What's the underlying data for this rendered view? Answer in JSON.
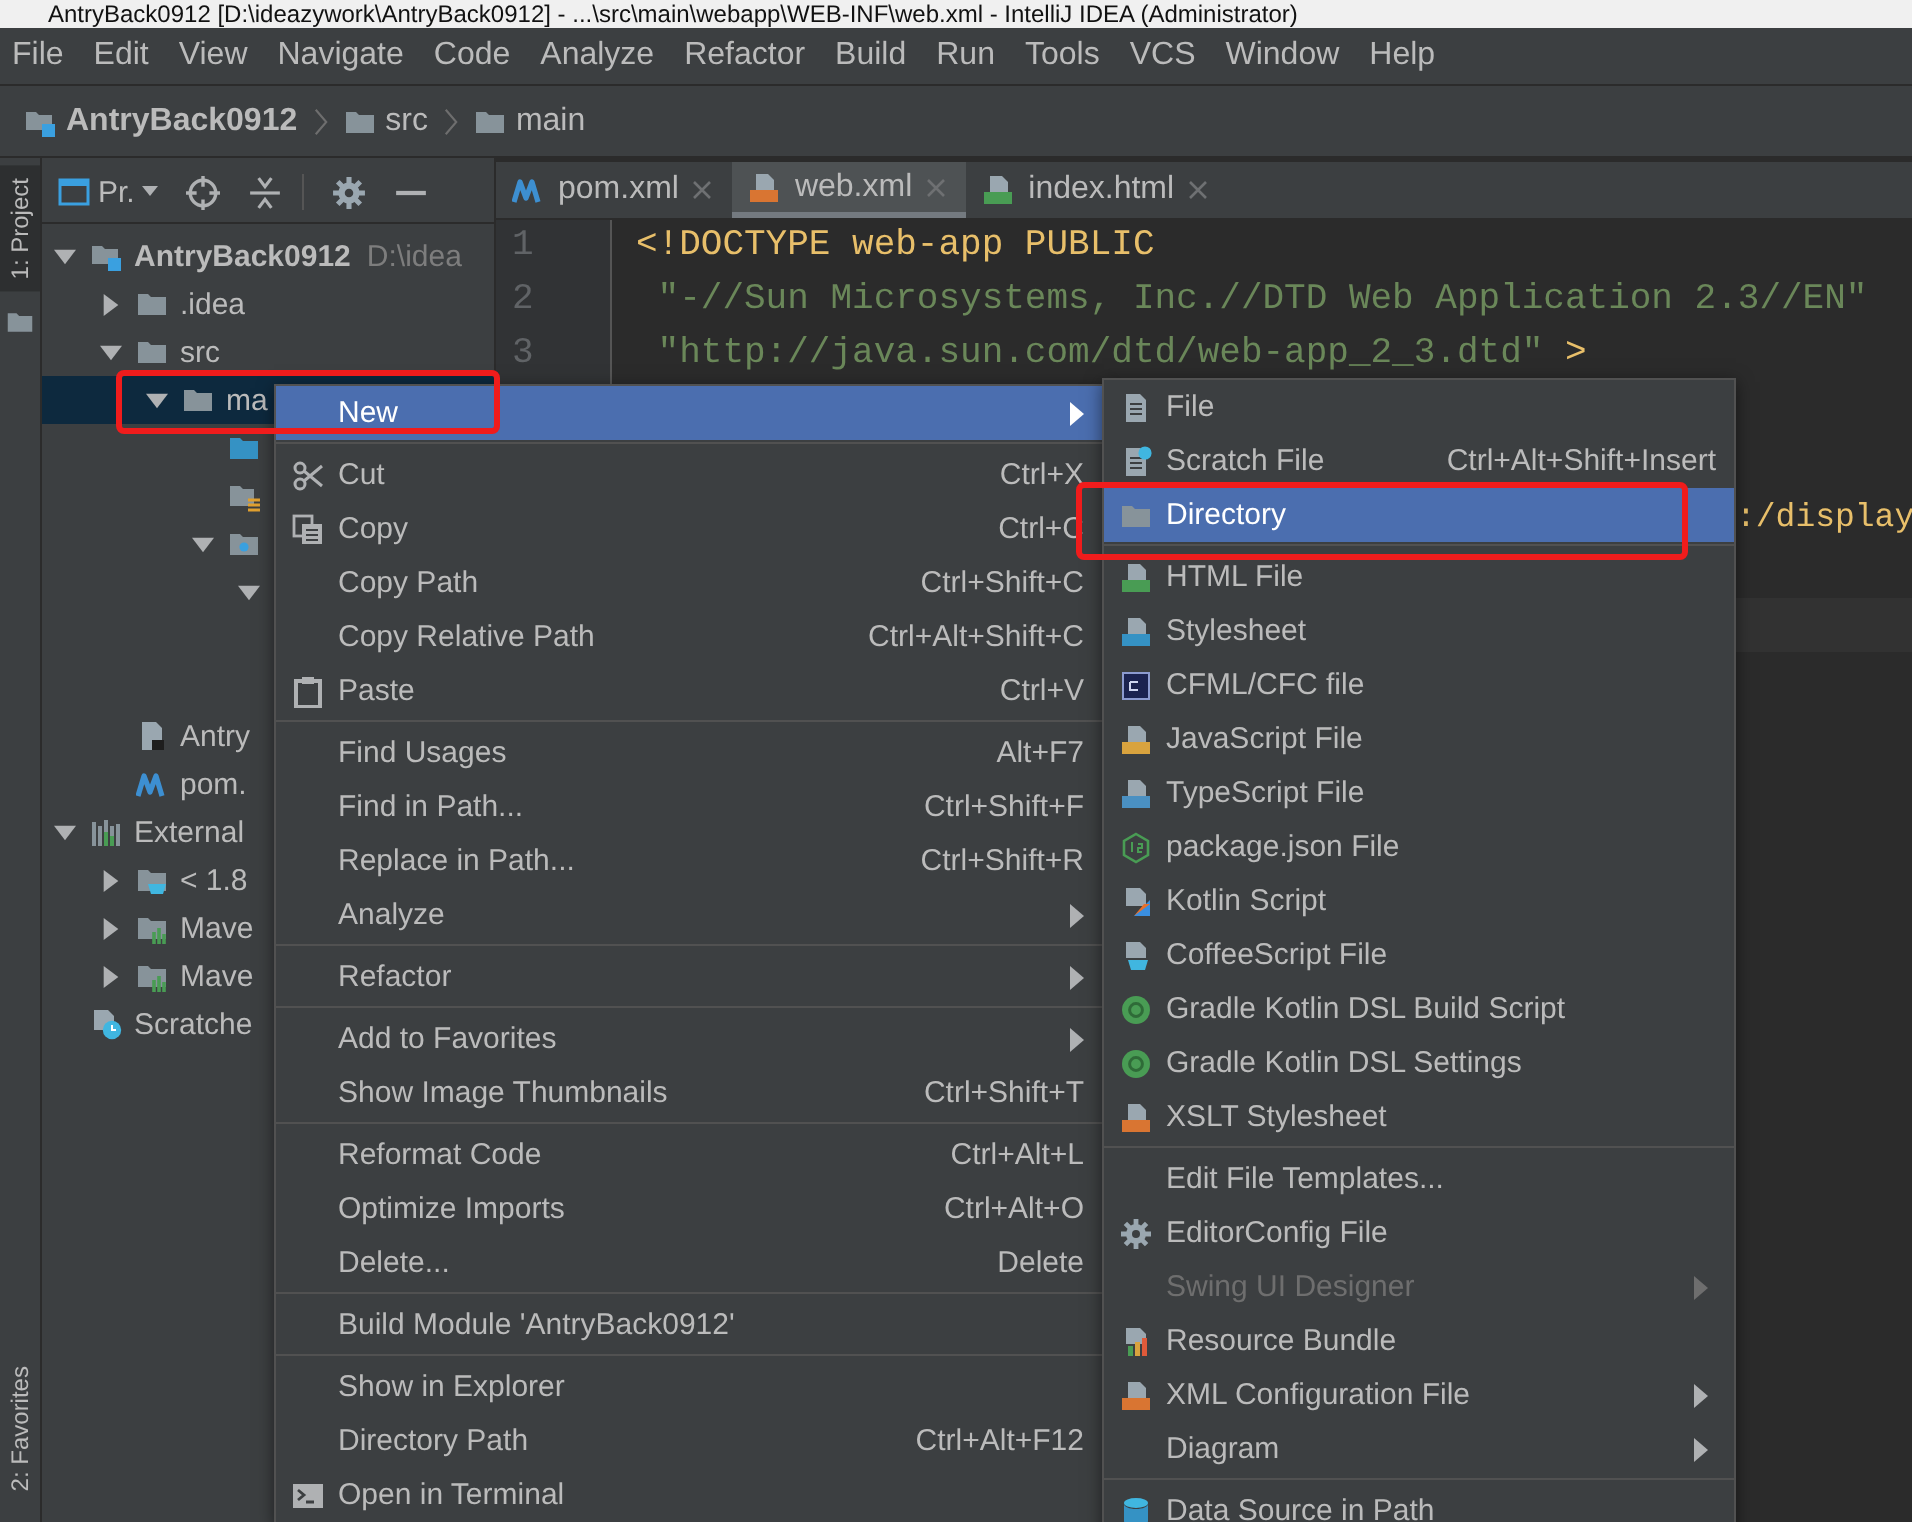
{
  "window": {
    "title": "AntryBack0912 [D:\\ideazywork\\AntryBack0912] - ...\\src\\main\\webapp\\WEB-INF\\web.xml - IntelliJ IDEA (Administrator)"
  },
  "menu_bar": [
    "File",
    "Edit",
    "View",
    "Navigate",
    "Code",
    "Analyze",
    "Refactor",
    "Build",
    "Run",
    "Tools",
    "VCS",
    "Window",
    "Help"
  ],
  "breadcrumb": [
    {
      "label": "AntryBack0912",
      "kind": "module"
    },
    {
      "label": "src",
      "kind": "folder"
    },
    {
      "label": "main",
      "kind": "folder"
    }
  ],
  "tool_strip": [
    {
      "label": "1: Project",
      "selected": true
    },
    {
      "label": "2: Favorites",
      "selected": false
    }
  ],
  "project": {
    "view_label": "Pr.",
    "tree": [
      {
        "label": "AntryBack0912",
        "hint": "D:\\idea",
        "kind": "module",
        "expanded": true,
        "selected": false,
        "children": [
          {
            "label": ".idea",
            "kind": "folder",
            "expanded": false,
            "selected": false
          },
          {
            "label": "src",
            "kind": "folder",
            "expanded": true,
            "selected": false,
            "children": [
              {
                "label": "ma",
                "kind": "folder",
                "expanded": true,
                "selected": true,
                "children": [
                  {
                    "kind": "folder-src",
                    "selected": false
                  },
                  {
                    "kind": "folder-res",
                    "selected": false
                  },
                  {
                    "kind": "folder-web",
                    "expanded": true,
                    "selected": false,
                    "children": [
                      {
                        "expanded": true,
                        "selected": false
                      }
                    ]
                  }
                ]
              }
            ]
          },
          {
            "label": "Antry",
            "kind": "iml",
            "selected": false
          },
          {
            "label": "pom.",
            "kind": "zigzag",
            "selected": false
          }
        ]
      },
      {
        "label": "External",
        "kind": "library",
        "expanded": true,
        "selected": false,
        "children": [
          {
            "label": "< 1.8",
            "kind": "jdk",
            "expanded": false,
            "selected": false
          },
          {
            "label": "Mave",
            "kind": "maven-lib",
            "expanded": false,
            "selected": false
          },
          {
            "label": "Mave",
            "kind": "maven-lib",
            "expanded": false,
            "selected": false
          }
        ]
      },
      {
        "label": "Scratche",
        "kind": "scratches",
        "selected": false
      }
    ]
  },
  "editor_tabs": [
    {
      "label": "pom.xml",
      "kind": "zigzag",
      "selected": false
    },
    {
      "label": "web.xml",
      "kind": "doc-xml",
      "selected": true
    },
    {
      "label": "index.html",
      "kind": "doc-html",
      "selected": false
    }
  ],
  "code_lines": [
    {
      "number": "1",
      "tokens": [
        {
          "text": "<!DOCTYPE web-app PUBLIC",
          "kind": "tag"
        }
      ]
    },
    {
      "number": "2",
      "tokens": [
        {
          "text": " \"-//Sun Microsystems, Inc.//DTD Web Application 2.3//EN\"",
          "kind": "string"
        }
      ]
    },
    {
      "number": "3",
      "tokens": [
        {
          "text": " \"http://java.sun.com/dtd/web-app_2_3.dtd\"",
          "kind": "string"
        },
        {
          "text": " >",
          "kind": "tag"
        }
      ]
    },
    {
      "kind": "covered"
    },
    {
      "kind": "covered"
    },
    {
      "kind": "tail",
      "tokens": [
        {
          "text": ":/display",
          "kind": "tag"
        }
      ]
    },
    {
      "kind": "covered"
    },
    {
      "kind": "covered",
      "current": true
    }
  ],
  "context_menu": {
    "sections": [
      [
        {
          "label": "New",
          "submenu": true,
          "selected": true,
          "circled": true
        }
      ],
      [
        {
          "label": "Cut",
          "kind": "scissors",
          "shortcut": "Ctrl+X",
          "selected": false
        },
        {
          "label": "Copy",
          "kind": "copy",
          "shortcut": "Ctrl+C",
          "selected": false
        },
        {
          "label": "Copy Path",
          "shortcut": "Ctrl+Shift+C",
          "selected": false
        },
        {
          "label": "Copy Relative Path",
          "shortcut": "Ctrl+Alt+Shift+C",
          "selected": false
        },
        {
          "label": "Paste",
          "kind": "paste",
          "shortcut": "Ctrl+V",
          "selected": false
        }
      ],
      [
        {
          "label": "Find Usages",
          "shortcut": "Alt+F7",
          "selected": false
        },
        {
          "label": "Find in Path...",
          "shortcut": "Ctrl+Shift+F",
          "selected": false
        },
        {
          "label": "Replace in Path...",
          "shortcut": "Ctrl+Shift+R",
          "selected": false
        },
        {
          "label": "Analyze",
          "submenu": true,
          "selected": false
        }
      ],
      [
        {
          "label": "Refactor",
          "submenu": true,
          "selected": false
        }
      ],
      [
        {
          "label": "Add to Favorites",
          "submenu": true,
          "selected": false
        },
        {
          "label": "Show Image Thumbnails",
          "shortcut": "Ctrl+Shift+T",
          "selected": false
        }
      ],
      [
        {
          "label": "Reformat Code",
          "shortcut": "Ctrl+Alt+L",
          "selected": false
        },
        {
          "label": "Optimize Imports",
          "shortcut": "Ctrl+Alt+O",
          "selected": false
        },
        {
          "label": "Delete...",
          "shortcut": "Delete",
          "selected": false
        }
      ],
      [
        {
          "label": "Build Module 'AntryBack0912'",
          "selected": false
        }
      ],
      [
        {
          "label": "Show in Explorer",
          "selected": false
        },
        {
          "label": "Directory Path",
          "shortcut": "Ctrl+Alt+F12",
          "selected": false
        },
        {
          "label": "Open in Terminal",
          "kind": "terminal",
          "selected": false
        }
      ]
    ]
  },
  "new_submenu": {
    "sections": [
      [
        {
          "label": "File",
          "kind": "doc",
          "selected": false,
          "disabled": false
        },
        {
          "label": "Scratch File",
          "kind": "scratch",
          "shortcut": "Ctrl+Alt+Shift+Insert",
          "selected": false,
          "disabled": false
        },
        {
          "label": "Directory",
          "kind": "folder",
          "selected": true,
          "disabled": false,
          "circled": true
        }
      ],
      [
        {
          "label": "HTML File",
          "kind": "doc-html",
          "selected": false,
          "disabled": false
        },
        {
          "label": "Stylesheet",
          "kind": "doc-css",
          "selected": false,
          "disabled": false
        },
        {
          "label": "CFML/CFC file",
          "kind": "cf",
          "selected": false,
          "disabled": false
        },
        {
          "label": "JavaScript File",
          "kind": "doc-js",
          "selected": false,
          "disabled": false
        },
        {
          "label": "TypeScript File",
          "kind": "doc-ts",
          "selected": false,
          "disabled": false
        },
        {
          "label": "package.json File",
          "kind": "node",
          "selected": false,
          "disabled": false
        },
        {
          "label": "Kotlin Script",
          "kind": "kotlin",
          "selected": false,
          "disabled": false
        },
        {
          "label": "CoffeeScript File",
          "kind": "coffee",
          "selected": false,
          "disabled": false
        },
        {
          "label": "Gradle Kotlin DSL Build Script",
          "kind": "gradle",
          "selected": false,
          "disabled": false
        },
        {
          "label": "Gradle Kotlin DSL Settings",
          "kind": "gradle",
          "selected": false,
          "disabled": false
        },
        {
          "label": "XSLT Stylesheet",
          "kind": "doc-xml",
          "selected": false,
          "disabled": false
        }
      ],
      [
        {
          "label": "Edit File Templates...",
          "selected": false,
          "disabled": false
        },
        {
          "label": "EditorConfig File",
          "kind": "gear",
          "selected": false,
          "disabled": false
        },
        {
          "label": "Swing UI Designer",
          "submenu": true,
          "selected": false,
          "disabled": true
        },
        {
          "label": "Resource Bundle",
          "kind": "bundle",
          "selected": false,
          "disabled": false
        },
        {
          "label": "XML Configuration File",
          "kind": "doc-xml",
          "submenu": true,
          "selected": false,
          "disabled": false
        },
        {
          "label": "Diagram",
          "submenu": true,
          "selected": false,
          "disabled": false
        }
      ],
      [
        {
          "label": "Data Source in Path",
          "kind": "db",
          "selected": false,
          "disabled": false
        }
      ]
    ]
  }
}
